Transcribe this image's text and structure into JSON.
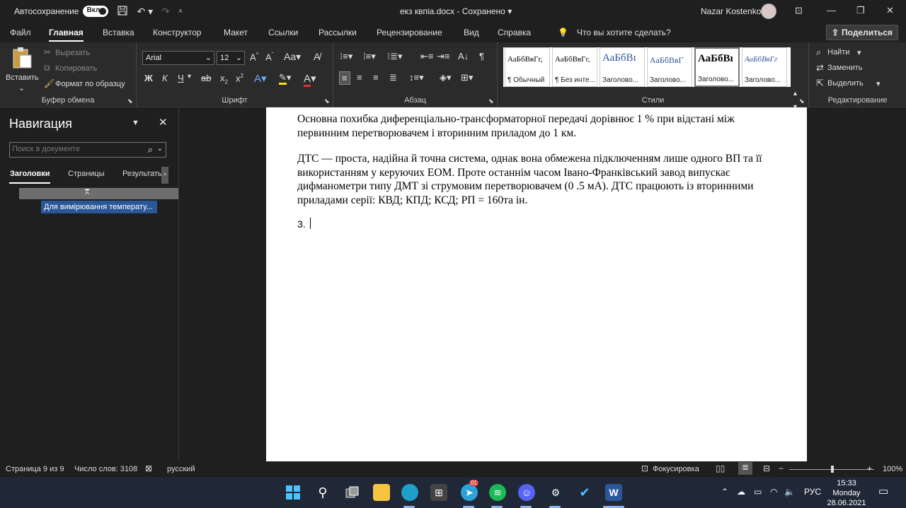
{
  "titlebar": {
    "autosave_label": "Автосохранение",
    "autosave_state": "Вкл.",
    "document_title": "екз квпіа.docx  -  Сохранено  ▾",
    "user_name": "Nazar Kostenko"
  },
  "menu": {
    "tabs": [
      "Файл",
      "Главная",
      "Вставка",
      "Конструктор",
      "Макет",
      "Ссылки",
      "Рассылки",
      "Рецензирование",
      "Вид",
      "Справка"
    ],
    "active_tab": "Главная",
    "tell_me": "Что вы хотите сделать?",
    "share_label": "Поделиться"
  },
  "ribbon": {
    "clipboard": {
      "paste_label": "Вставить",
      "cut_label": "Вырезать",
      "copy_label": "Копировать",
      "format_painter_label": "Формат по образцу",
      "group_label": "Буфер обмена"
    },
    "font": {
      "font_name": "Arial",
      "font_size": "12",
      "bold": "Ж",
      "italic": "К",
      "underline": "Ч",
      "group_label": "Шрифт"
    },
    "paragraph": {
      "group_label": "Абзац"
    },
    "styles": {
      "group_label": "Стили",
      "items": [
        {
          "preview": "АаБбВвГг,",
          "name": "¶ Обычный"
        },
        {
          "preview": "АаБбВвГг,",
          "name": "¶ Без инте..."
        },
        {
          "preview": "АаБбВı",
          "name": "Заголово..."
        },
        {
          "preview": "АаБбВвГ",
          "name": "Заголово..."
        },
        {
          "preview": "АаБбВı",
          "name": "Заголово..."
        },
        {
          "preview": "АаБбВвГг",
          "name": "Заголово..."
        }
      ]
    },
    "editing": {
      "find_label": "Найти",
      "replace_label": "Заменить",
      "select_label": "Выделить",
      "group_label": "Редактирование"
    }
  },
  "navigation": {
    "title": "Навигация",
    "search_placeholder": "Поиск в документе",
    "tabs": [
      "Заголовки",
      "Страницы",
      "Результаты"
    ],
    "heading_item": "Для вимірювання температу..."
  },
  "document": {
    "paragraph_1": "Основна похибка диференціально-трансформаторної передачі дорівнює 1 % при відстані між первинним перетворювачем і вторинним приладом до 1 км.",
    "paragraph_2": "ДТС — проста, надійна й точна система, однак вона обмежена підключенням лише одного ВП та її використанням у керуючих ЕОМ. Проте останнім часом Івано-Франківський завод випускає дифманометри типу ДМТ зі струмовим перетворювачем (0 .5 мА). ДТС працюють із вторинними приладами серії: КВД; КПД; КСД; РП = 160та ін.",
    "list_item": "3."
  },
  "statusbar": {
    "page": "Страница 9 из 9",
    "word_count": "Число слов: 3108",
    "language": "русский",
    "focus_label": "Фокусировка",
    "zoom": "100%",
    "zoom_level_percent": 100
  },
  "taskbar": {
    "lang": "РУС",
    "time": "15:33",
    "day": "Monday",
    "date": "28.06.2021",
    "badge": "01"
  }
}
